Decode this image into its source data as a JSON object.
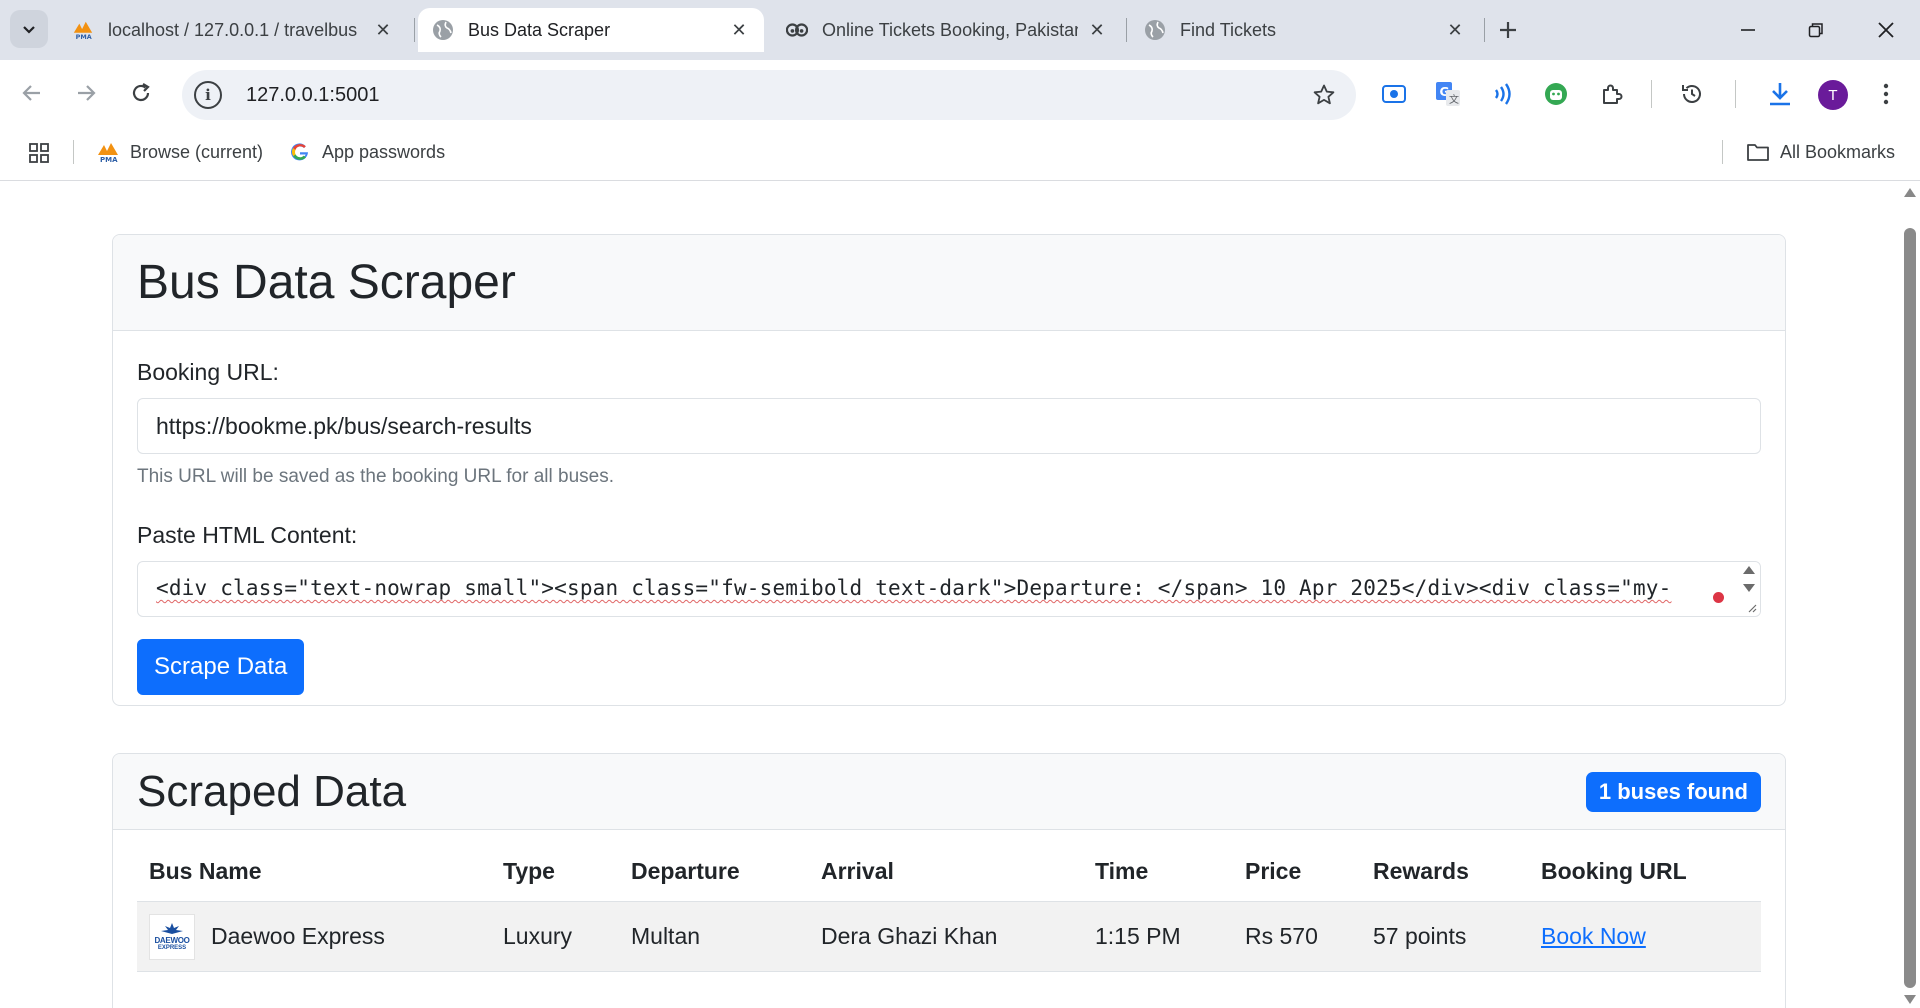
{
  "browser": {
    "tabs": [
      {
        "title": "localhost / 127.0.0.1 / travelbus",
        "favicon": "pma-icon",
        "active": false
      },
      {
        "title": "Bus Data Scraper",
        "favicon": "globe-icon",
        "active": true
      },
      {
        "title": "Online Tickets Booking, Pakistan",
        "favicon": "bookme-icon",
        "active": false
      },
      {
        "title": "Find Tickets",
        "favicon": "globe-icon",
        "active": false
      }
    ],
    "url": "127.0.0.1:5001",
    "avatar_letter": "T",
    "bookmarks": [
      {
        "label": "Browse (current)",
        "icon": "pma-icon"
      },
      {
        "label": "App passwords",
        "icon": "google-icon"
      }
    ],
    "all_bookmarks_label": "All Bookmarks"
  },
  "scraper": {
    "title": "Bus Data Scraper",
    "url_label": "Booking URL:",
    "url_value": "https://bookme.pk/bus/search-results",
    "url_help": "This URL will be saved as the booking URL for all buses.",
    "html_label": "Paste HTML Content:",
    "html_value": "<div class=\"text-nowrap small\"><span class=\"fw-semibold text-dark\">Departure: </span> 10 Apr 2025</div><div class=\"my-",
    "submit_label": "Scrape Data"
  },
  "results": {
    "title": "Scraped Data",
    "count_badge": "1 buses found",
    "columns": [
      "Bus Name",
      "Type",
      "Departure",
      "Arrival",
      "Time",
      "Price",
      "Rewards",
      "Booking URL"
    ],
    "rows": [
      {
        "bus_name": "Daewoo Express",
        "logo_text_1": "DAEWOO",
        "logo_text_2": "EXPRESS",
        "type": "Luxury",
        "departure": "Multan",
        "arrival": "Dera Ghazi Khan",
        "time": "1:15 PM",
        "price": "Rs 570",
        "rewards": "57 points",
        "booking_link": "Book Now"
      }
    ]
  },
  "colors": {
    "primary": "#0d6efd",
    "tabstrip": "#dfe3eb",
    "avatar": "#6a1b9a"
  }
}
